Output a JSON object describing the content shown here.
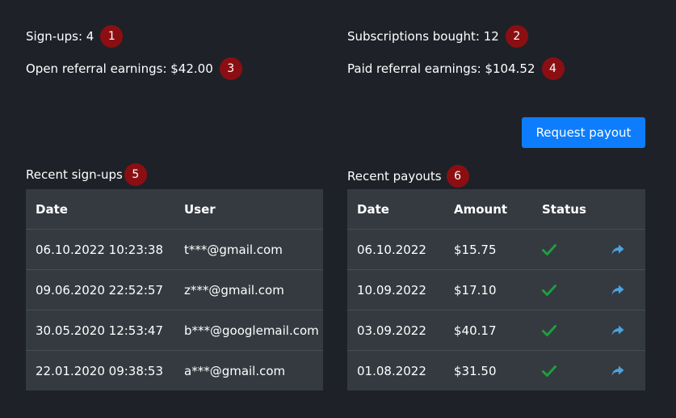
{
  "stats": {
    "signups": {
      "text": "Sign-ups: 4",
      "badge": "1"
    },
    "subscriptions": {
      "text": "Subscriptions bought: 12",
      "badge": "2"
    },
    "open_earnings": {
      "text": "Open referral earnings: $42.00",
      "badge": "3"
    },
    "paid_earnings": {
      "text": "Paid referral earnings: $104.52",
      "badge": "4"
    }
  },
  "request_payout_label": "Request payout",
  "recent_signups": {
    "title": "Recent sign-ups",
    "badge": "5",
    "columns": [
      "Date",
      "User"
    ],
    "rows": [
      {
        "date": "06.10.2022 10:23:38",
        "user": "t***@gmail.com"
      },
      {
        "date": "09.06.2020 22:52:57",
        "user": "z***@gmail.com"
      },
      {
        "date": "30.05.2020 12:53:47",
        "user": "b***@googlemail.com"
      },
      {
        "date": "22.01.2020 09:38:53",
        "user": "a***@gmail.com"
      }
    ]
  },
  "recent_payouts": {
    "title": "Recent payouts",
    "badge": "6",
    "columns": [
      "Date",
      "Amount",
      "Status",
      ""
    ],
    "rows": [
      {
        "date": "06.10.2022",
        "amount": "$15.75",
        "status_icon": "check-icon",
        "action_icon": "share-icon"
      },
      {
        "date": "10.09.2022",
        "amount": "$17.10",
        "status_icon": "check-icon",
        "action_icon": "share-icon"
      },
      {
        "date": "03.09.2022",
        "amount": "$40.17",
        "status_icon": "check-icon",
        "action_icon": "share-icon"
      },
      {
        "date": "01.08.2022",
        "amount": "$31.50",
        "status_icon": "check-icon",
        "action_icon": "share-icon"
      }
    ]
  },
  "colors": {
    "background": "#1e2228",
    "table_background": "#343a40",
    "badge": "#8b0f12",
    "button": "#0d7dfd",
    "check": "#1e9e3e",
    "share": "#4aa3df"
  }
}
